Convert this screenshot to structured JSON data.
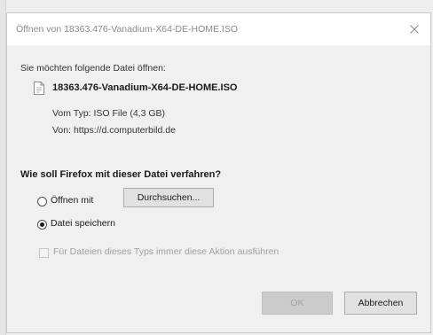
{
  "window": {
    "title": "Öffnen von 18363.476-Vanadium-X64-DE-HOME.ISO"
  },
  "intro": "Sie möchten folgende Datei öffnen:",
  "file": {
    "name": "18363.476-Vanadium-X64-DE-HOME.ISO",
    "type_line": "Vom Typ:  ISO File (4,3 GB)",
    "from_line": "Von:  https://d.computerbild.de",
    "icon": "file-icon"
  },
  "question": "Wie soll Firefox mit dieser Datei verfahren?",
  "options": {
    "open_label": "Öffnen mit",
    "browse_label": "Durchsuchen...",
    "save_label": "Datei speichern",
    "selected": "save",
    "always_label": "Für Dateien dieses Typs immer diese Aktion ausführen",
    "always_checked": false,
    "always_enabled": false
  },
  "buttons": {
    "ok_label": "OK",
    "ok_enabled": false,
    "cancel_label": "Abbrechen"
  },
  "colors": {
    "dialog_bg": "#f0f0f0",
    "titlebar_bg": "#ffffff",
    "disabled_text": "#a0a0a0",
    "button_bg": "#e1e1e1"
  }
}
